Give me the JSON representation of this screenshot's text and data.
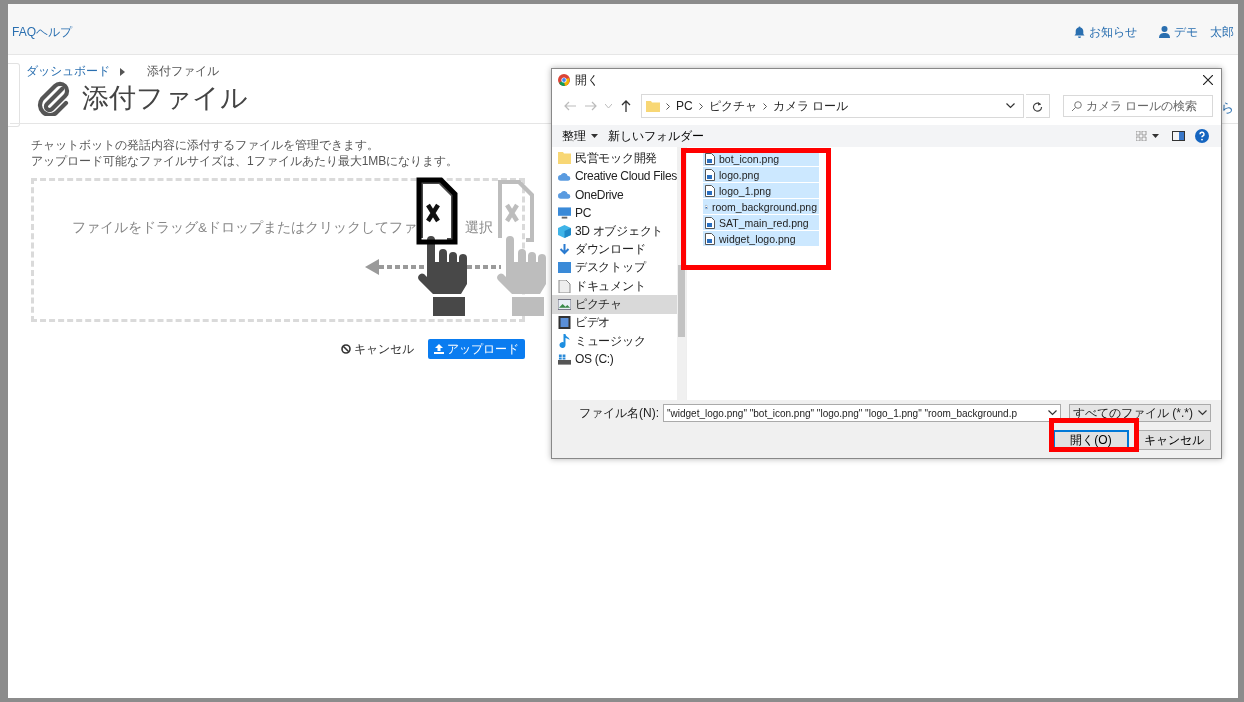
{
  "top_bar": {
    "help_link": "FAQヘルプ",
    "notifications": "お知らせ",
    "user": "デモ　太郎"
  },
  "breadcrumb": [
    {
      "label": "ダッシュボード"
    },
    {
      "label": "添付ファイル"
    }
  ],
  "page_title": "添付ファイル",
  "description": [
    "チャットボットの発話内容に添付するファイルを管理できます。",
    "アップロード可能なファイルサイズは、1ファイルあたり最大1MBになります。"
  ],
  "dropzone": {
    "text_parts": [
      "ファイルをドラッグ&ドロップまたはクリックしてファ",
      "選択"
    ]
  },
  "buttons": [
    {
      "label": "キャンセル",
      "kind": "cancel"
    },
    {
      "label": "アップロード",
      "kind": "upload"
    }
  ],
  "edge_text": "ら",
  "dialog": {
    "title": "開く",
    "path": [
      "PC",
      "ピクチャ",
      "カメラ ロール"
    ],
    "search": {
      "placeholder": "カメラ ロールの検索"
    },
    "toolbar": [
      "整理",
      "新しいフォルダー"
    ],
    "nav": [
      {
        "label": "民営モック開発",
        "kind": "folder",
        "selected": false
      },
      {
        "label": "Creative Cloud Files",
        "kind": "cloud",
        "selected": false
      },
      {
        "label": "OneDrive",
        "kind": "cloud",
        "selected": false
      },
      {
        "label": "PC",
        "kind": "pc",
        "selected": false,
        "children": [
          {
            "label": "3D オブジェクト",
            "kind": "cube",
            "selected": false
          },
          {
            "label": "ダウンロード",
            "kind": "download",
            "selected": false
          },
          {
            "label": "デスクトップ",
            "kind": "desktop",
            "selected": false
          },
          {
            "label": "ドキュメント",
            "kind": "document",
            "selected": false
          },
          {
            "label": "ピクチャ",
            "kind": "picture",
            "selected": true
          },
          {
            "label": "ビデオ",
            "kind": "video",
            "selected": false
          },
          {
            "label": "ミュージック",
            "kind": "music",
            "selected": false
          },
          {
            "label": "OS (C:)",
            "kind": "disk",
            "selected": false
          }
        ]
      }
    ],
    "files": [
      {
        "name": "bot_icon.png",
        "selected": true
      },
      {
        "name": "logo.png",
        "selected": true
      },
      {
        "name": "logo_1.png",
        "selected": true
      },
      {
        "name": "room_background.png",
        "selected": true
      },
      {
        "name": "SAT_main_red.png",
        "selected": true
      },
      {
        "name": "widget_logo.png",
        "selected": true
      }
    ],
    "filename_label": "ファイル名(N):",
    "filename_value": "\"widget_logo.png\" \"bot_icon.png\" \"logo.png\" \"logo_1.png\" \"room_background.p",
    "filetype": "すべてのファイル (*.*)",
    "buttons": [
      {
        "label": "開く(O)",
        "kind": "default"
      },
      {
        "label": "キャンセル",
        "kind": "normal"
      }
    ]
  }
}
